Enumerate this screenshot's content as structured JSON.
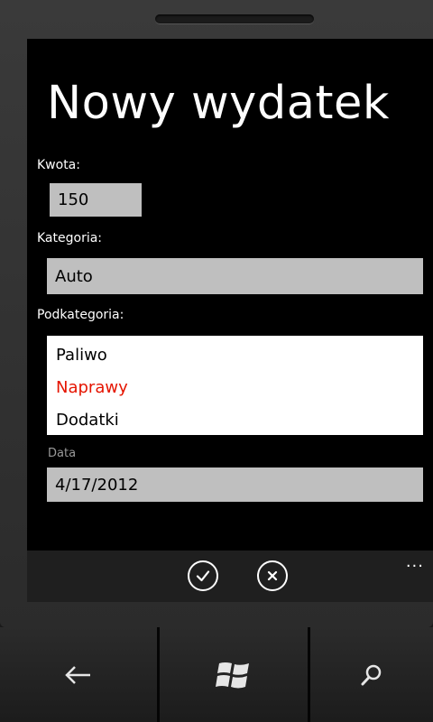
{
  "page": {
    "title": "Nowy wydatek"
  },
  "form": {
    "amount": {
      "label": "Kwota:",
      "value": "150"
    },
    "category": {
      "label": "Kategoria:",
      "value": "Auto"
    },
    "subcategory": {
      "label": "Podkategoria:",
      "options": [
        "Paliwo",
        "Naprawy",
        "Dodatki"
      ],
      "selected": "Naprawy"
    },
    "date": {
      "label": "Data",
      "value": "4/17/2012"
    }
  },
  "appbar": {
    "ellipsis": "..."
  },
  "icons": {
    "confirm": "check-icon",
    "cancel": "close-icon",
    "back": "back-arrow-icon",
    "start": "windows-logo-icon",
    "search": "search-icon"
  },
  "colors": {
    "accent": "#e51400",
    "field": "#bfbfbf",
    "background": "#000000"
  }
}
